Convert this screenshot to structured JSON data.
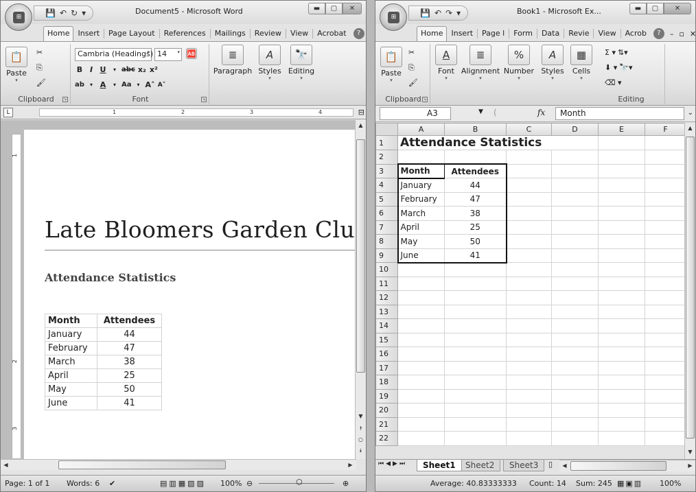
{
  "word": {
    "title": "Document5 - Microsoft Word",
    "tabs": [
      "Home",
      "Insert",
      "Page Layout",
      "References",
      "Mailings",
      "Review",
      "View",
      "Acrobat"
    ],
    "ribbon": {
      "paste": "Paste",
      "clipboard": "Clipboard",
      "font_name": "Cambria (Headings)",
      "font_size": "14",
      "font_group": "Font",
      "paragraph": "Paragraph",
      "styles": "Styles",
      "editing": "Editing"
    },
    "ruler_numbers": [
      "1",
      "2",
      "3",
      "4"
    ],
    "ruler_v_numbers": [
      "1",
      "2",
      "3"
    ],
    "doc": {
      "title": "Late Bloomers Garden Club",
      "heading": "Attendance Statistics",
      "headers": [
        "Month",
        "Attendees"
      ],
      "rows": [
        [
          "January",
          "44"
        ],
        [
          "February",
          "47"
        ],
        [
          "March",
          "38"
        ],
        [
          "April",
          "25"
        ],
        [
          "May",
          "50"
        ],
        [
          "June",
          "41"
        ]
      ]
    },
    "status": {
      "page": "Page: 1 of 1",
      "words": "Words: 6",
      "zoom": "100%"
    }
  },
  "excel": {
    "title": "Book1 - Microsoft Ex...",
    "tabs": [
      "Home",
      "Insert",
      "Page l",
      "Form",
      "Data",
      "Revie",
      "View",
      "Acrob"
    ],
    "ribbon": {
      "paste": "Paste",
      "clipboard": "Clipboard",
      "font": "Font",
      "alignment": "Alignment",
      "number": "Number",
      "styles": "Styles",
      "cells": "Cells",
      "editing": "Editing"
    },
    "name_box": "A3",
    "fx": "fx",
    "formula": "Month",
    "columns": [
      "A",
      "B",
      "C",
      "D",
      "E",
      "F"
    ],
    "row_numbers": [
      "1",
      "2",
      "3",
      "4",
      "5",
      "6",
      "7",
      "8",
      "9",
      "10",
      "11",
      "12",
      "13",
      "14",
      "15",
      "16",
      "17",
      "18",
      "19",
      "20",
      "21",
      "22"
    ],
    "sheet_title": "Attendance Statistics",
    "headers": [
      "Month",
      "Attendees"
    ],
    "rows": [
      [
        "January",
        "44"
      ],
      [
        "February",
        "47"
      ],
      [
        "March",
        "38"
      ],
      [
        "April",
        "25"
      ],
      [
        "May",
        "50"
      ],
      [
        "June",
        "41"
      ]
    ],
    "sheets": [
      "Sheet1",
      "Sheet2",
      "Sheet3"
    ],
    "status": {
      "average": "Average: 40.83333333",
      "count": "Count: 14",
      "sum": "Sum: 245",
      "zoom": "100%"
    }
  }
}
